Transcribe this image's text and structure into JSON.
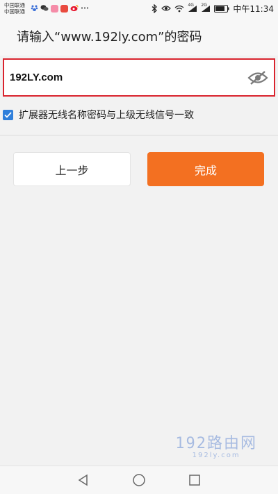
{
  "status_bar": {
    "carrier_1": "中国联通",
    "carrier_2": "中国联通",
    "signal_1_label": "4G",
    "signal_2_label": "2G",
    "time": "中午11:34",
    "notification_icons": [
      "baidu-icon",
      "wechat-icon",
      "app-icon-pink",
      "app-icon-red",
      "weibo-icon",
      "more-icon"
    ]
  },
  "header": {
    "title": "请输入“www.192ly.com”的密码"
  },
  "password_field": {
    "value": "192LY.com",
    "visibility_icon": "eye-slash-icon"
  },
  "sync_option": {
    "checked": true,
    "label": "扩展器无线名称密码与上级无线信号一致"
  },
  "buttons": {
    "prev_label": "上一步",
    "done_label": "完成"
  },
  "watermark": {
    "main": "192路由网",
    "sub": "192ly.com"
  },
  "colors": {
    "accent_orange": "#f37021",
    "highlight_red": "#d9232d",
    "checkbox_blue": "#2f7fdb"
  },
  "nav_bar": {
    "icons": [
      "back-triangle-icon",
      "home-circle-icon",
      "recents-square-icon"
    ]
  }
}
